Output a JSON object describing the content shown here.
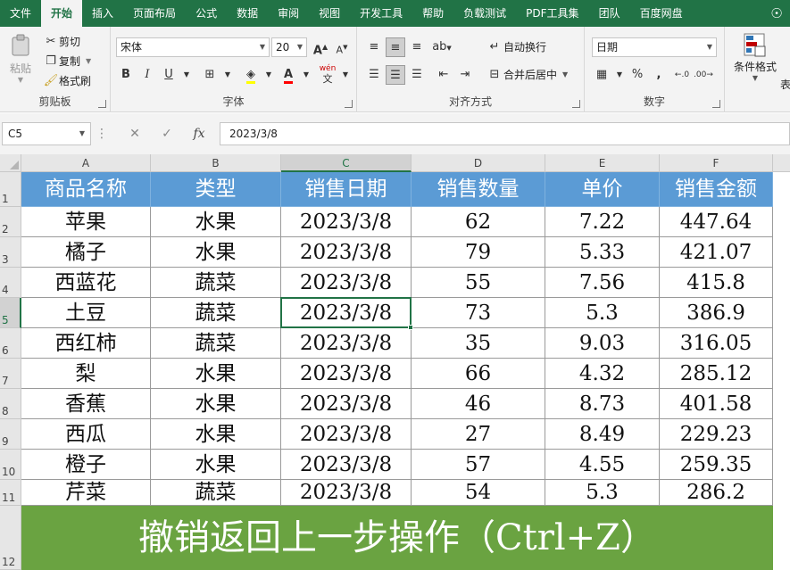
{
  "ribbon_tabs": [
    {
      "label": "文件",
      "active": false
    },
    {
      "label": "开始",
      "active": true
    },
    {
      "label": "插入",
      "active": false
    },
    {
      "label": "页面布局",
      "active": false
    },
    {
      "label": "公式",
      "active": false
    },
    {
      "label": "数据",
      "active": false
    },
    {
      "label": "审阅",
      "active": false
    },
    {
      "label": "视图",
      "active": false
    },
    {
      "label": "开发工具",
      "active": false
    },
    {
      "label": "帮助",
      "active": false
    },
    {
      "label": "负载测试",
      "active": false
    },
    {
      "label": "PDF工具集",
      "active": false
    },
    {
      "label": "团队",
      "active": false
    },
    {
      "label": "百度网盘",
      "active": false
    }
  ],
  "clipboard": {
    "paste": "粘贴",
    "cut": "剪切",
    "copy": "复制",
    "format_painter": "格式刷",
    "group_label": "剪贴板"
  },
  "font": {
    "name": "宋体",
    "size": "20",
    "bold": "B",
    "italic": "I",
    "underline": "U",
    "grow": "A",
    "shrink": "A",
    "font_color_letter": "A",
    "phonetic": "wén",
    "group_label": "字体"
  },
  "alignment": {
    "wrap_text": "自动换行",
    "merge_center": "合并后居中",
    "group_label": "对齐方式"
  },
  "number": {
    "format": "日期",
    "percent": "%",
    "comma": ",",
    "group_label": "数字"
  },
  "styles": {
    "conditional_formatting": "条件格式",
    "table_format_partial": "表"
  },
  "formula_bar": {
    "name_box": "C5",
    "cancel": "✕",
    "enter": "✓",
    "fx": "fx",
    "value": "2023/3/8"
  },
  "grid": {
    "columns": [
      "A",
      "B",
      "C",
      "D",
      "E",
      "F"
    ],
    "rows": [
      "1",
      "2",
      "3",
      "4",
      "5",
      "6",
      "7",
      "8",
      "9",
      "10",
      "11",
      "12"
    ],
    "selected_cell": "C5",
    "header": [
      "商品名称",
      "类型",
      "销售日期",
      "销售数量",
      "单价",
      "销售金额"
    ],
    "data": [
      [
        "苹果",
        "水果",
        "2023/3/8",
        "62",
        "7.22",
        "447.64"
      ],
      [
        "橘子",
        "水果",
        "2023/3/8",
        "79",
        "5.33",
        "421.07"
      ],
      [
        "西蓝花",
        "蔬菜",
        "2023/3/8",
        "55",
        "7.56",
        "415.8"
      ],
      [
        "土豆",
        "蔬菜",
        "2023/3/8",
        "73",
        "5.3",
        "386.9"
      ],
      [
        "西红柿",
        "蔬菜",
        "2023/3/8",
        "35",
        "9.03",
        "316.05"
      ],
      [
        "梨",
        "水果",
        "2023/3/8",
        "66",
        "4.32",
        "285.12"
      ],
      [
        "香蕉",
        "水果",
        "2023/3/8",
        "46",
        "8.73",
        "401.58"
      ],
      [
        "西瓜",
        "水果",
        "2023/3/8",
        "27",
        "8.49",
        "229.23"
      ],
      [
        "橙子",
        "水果",
        "2023/3/8",
        "57",
        "4.55",
        "259.35"
      ],
      [
        "芹菜",
        "蔬菜",
        "2023/3/8",
        "54",
        "5.3",
        "286.2"
      ]
    ],
    "banner": "撤销返回上一步操作（Ctrl+Z）"
  },
  "colors": {
    "ribbon_green": "#217346",
    "header_blue": "#5b9bd5",
    "banner_green": "#6aa341"
  }
}
